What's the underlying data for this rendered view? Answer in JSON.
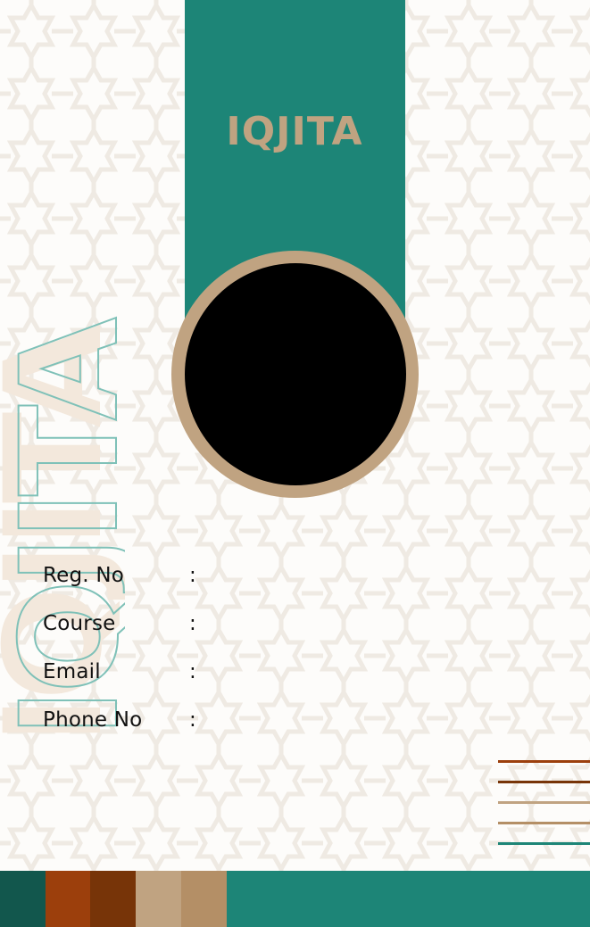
{
  "brand": {
    "logo_text": "IQJITA",
    "side_wordmark_text": "IQJITA"
  },
  "colors": {
    "teal": "#1d8577",
    "dark_teal": "#12574d",
    "rust": "#9c3f0c",
    "brown": "#773408",
    "sand": "#c0a381",
    "tan": "#b48f66",
    "photo_placeholder": "#000000"
  },
  "fields": [
    {
      "label": "Reg. No",
      "separator": ":"
    },
    {
      "label": "Course",
      "separator": ":"
    },
    {
      "label": "Email",
      "separator": ":"
    },
    {
      "label": "Phone No",
      "separator": ":"
    }
  ]
}
